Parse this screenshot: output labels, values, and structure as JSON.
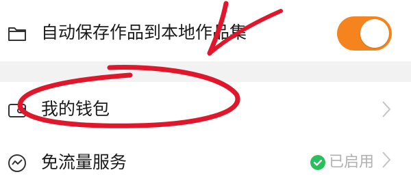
{
  "settings": {
    "autosave": {
      "icon": "folder-icon",
      "label": "自动保存作品到本地作品集",
      "toggle_on": true,
      "toggle_color": "#f5841f"
    },
    "wallet": {
      "icon": "wallet-icon",
      "label": "我的钱包"
    },
    "free_traffic": {
      "icon": "traffic-icon",
      "label": "免流量服务",
      "status_text": "已启用",
      "status_icon": "check-circle-icon",
      "status_color": "#27c05a"
    }
  },
  "annotation": {
    "color": "#e0162b",
    "marks": [
      "circle-around-wallet",
      "arrow-to-autosave"
    ]
  }
}
